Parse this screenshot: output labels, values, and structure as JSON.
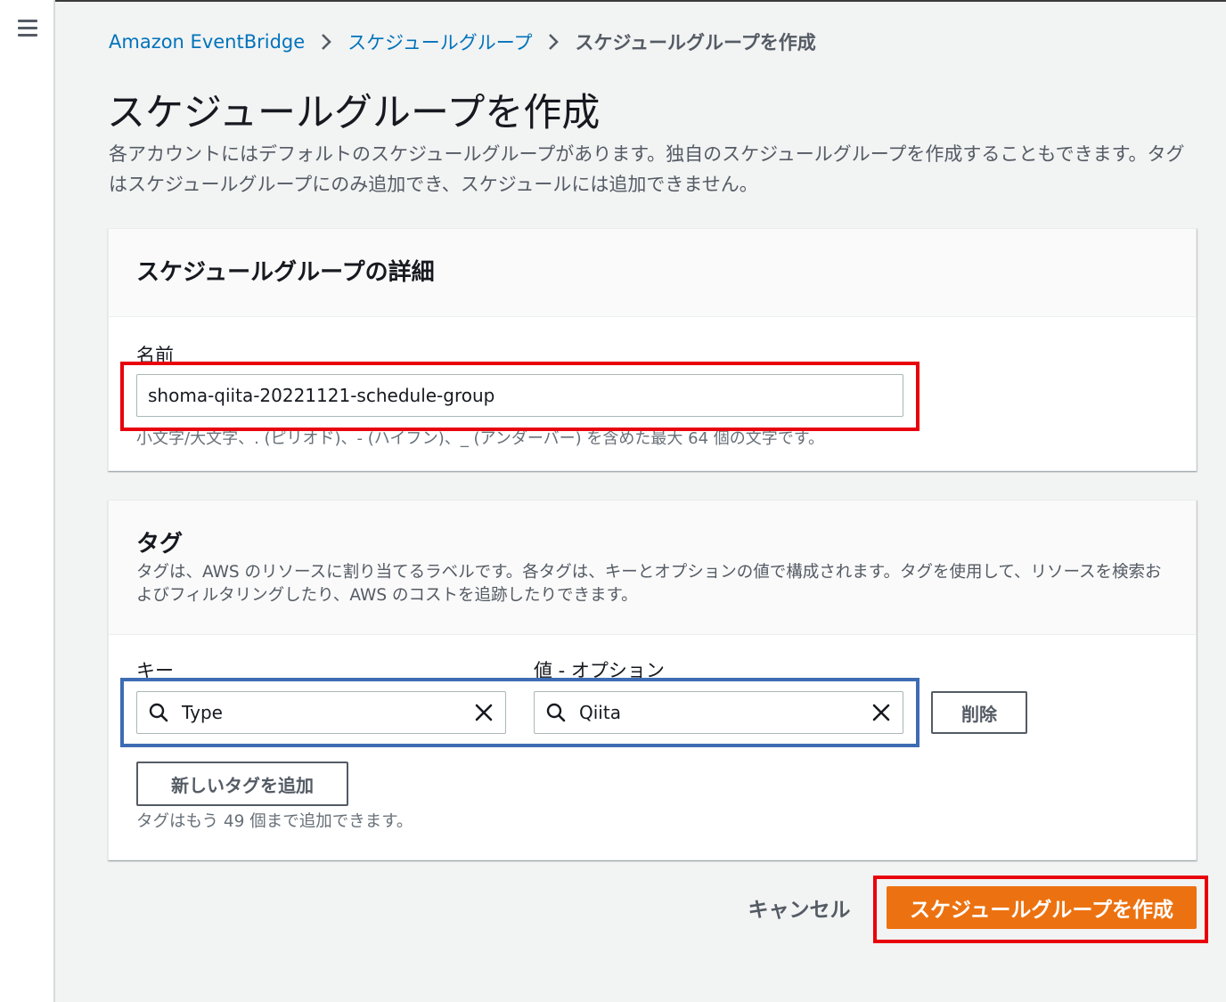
{
  "nav": {
    "menu_icon": "hamburger-menu-icon"
  },
  "breadcrumb": {
    "items": [
      "Amazon EventBridge",
      "スケジュールグループ"
    ],
    "current": "スケジュールグループを作成",
    "separator_icon": "chevron-right-icon"
  },
  "page": {
    "title": "スケジュールグループを作成",
    "description": "各アカウントにはデフォルトのスケジュールグループがあります。独自のスケジュールグループを作成することもできます。タグはスケジュールグループにのみ追加でき、スケジュールには追加できません。"
  },
  "details_panel": {
    "title": "スケジュールグループの詳細",
    "name_label": "名前",
    "name_value": "shoma-qiita-20221121-schedule-group",
    "name_constraint": "小文字/大文字、. (ピリオド)、- (ハイフン)、_ (アンダーバー) を含めた最大 64 個の文字です。"
  },
  "tags_panel": {
    "title": "タグ",
    "description": "タグは、AWS のリソースに割り当てるラベルです。各タグは、キーとオプションの値で構成されます。タグを使用して、リソースを検索およびフィルタリングしたり、AWS のコストを追跡したりできます。",
    "key_label": "キー",
    "value_label": "値 - オプション",
    "key_value": "Type",
    "value_value": "Qiita",
    "remove_label": "削除",
    "add_tag_label": "新しいタグを追加",
    "remaining_hint": "タグはもう 49 個まで追加できます。"
  },
  "footer": {
    "cancel_label": "キャンセル",
    "create_label": "スケジュールグループを作成"
  },
  "colors": {
    "link": "#0073bb",
    "primary_button": "#ec7211",
    "highlight_red": "#e8000b",
    "highlight_blue": "#3e6cb4"
  }
}
